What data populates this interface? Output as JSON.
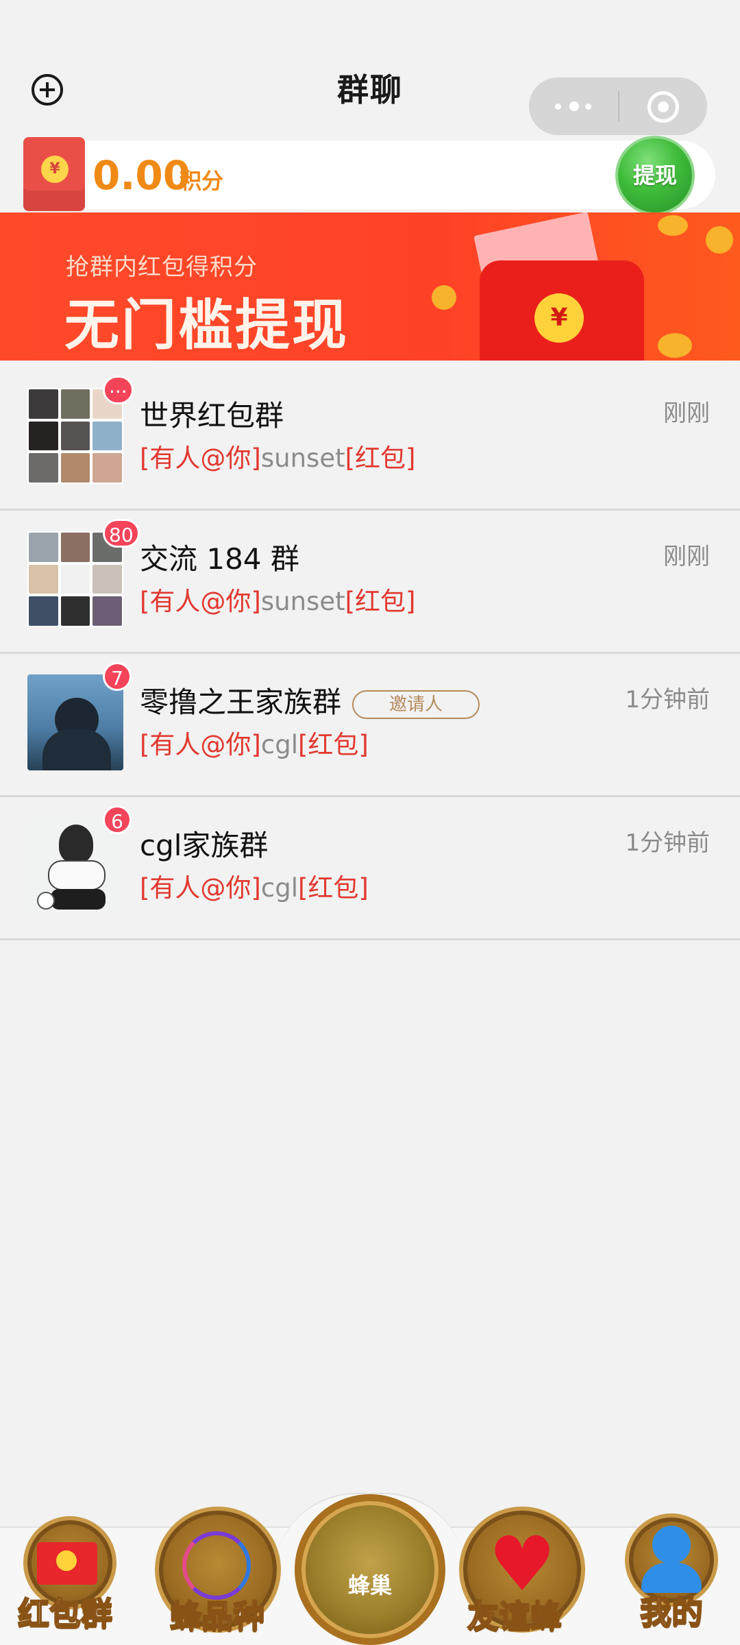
{
  "header": {
    "title": "群聊",
    "add_icon": "plus-circle-icon",
    "more_icon": "more-dots-icon",
    "close_icon": "target-circle-icon"
  },
  "points_bar": {
    "wallet_icon": "red-envelope-icon",
    "value": "0.00",
    "unit": "积分",
    "withdraw_label": "提现"
  },
  "banner": {
    "subtitle": "抢群内红包得积分",
    "title": "无门槛提现",
    "envelope_seal": "¥"
  },
  "groups": [
    {
      "name": "世界红包群",
      "time": "刚刚",
      "badge": "···",
      "avatar": "grid",
      "preview": {
        "at": "[有人@你]",
        "user": "sunset",
        "tag": "[红包]"
      },
      "invite": ""
    },
    {
      "name": "交流 184 群",
      "time": "刚刚",
      "badge": "80",
      "avatar": "grid",
      "preview": {
        "at": "[有人@你]",
        "user": "sunset",
        "tag": "[红包]"
      },
      "invite": ""
    },
    {
      "name": "零撸之王家族群",
      "time": "1分钟前",
      "badge": "7",
      "avatar": "photo",
      "preview": {
        "at": "[有人@你]",
        "user": "cgl",
        "tag": "[红包]"
      },
      "invite": "邀请人"
    },
    {
      "name": "cgl家族群",
      "time": "1分钟前",
      "badge": "6",
      "avatar": "illustration",
      "preview": {
        "at": "[有人@你]",
        "user": "cgl",
        "tag": "[红包]"
      },
      "invite": ""
    }
  ],
  "bottom_nav": {
    "items": [
      {
        "label": "红包群",
        "icon": "red-envelope-icon"
      },
      {
        "label": "蜂品种",
        "icon": "dna-icon"
      },
      {
        "label": "蜂巢",
        "icon": "hive-icon"
      },
      {
        "label": "友谊蜂",
        "icon": "heart-icon"
      },
      {
        "label": "我的",
        "icon": "user-icon"
      }
    ]
  },
  "colors": {
    "accent_orange": "#f08a16",
    "banner_red": "#ff4226",
    "highlight_red": "#e2382f",
    "badge_red": "#f3445a",
    "withdraw_green": "#3fbb3a"
  }
}
